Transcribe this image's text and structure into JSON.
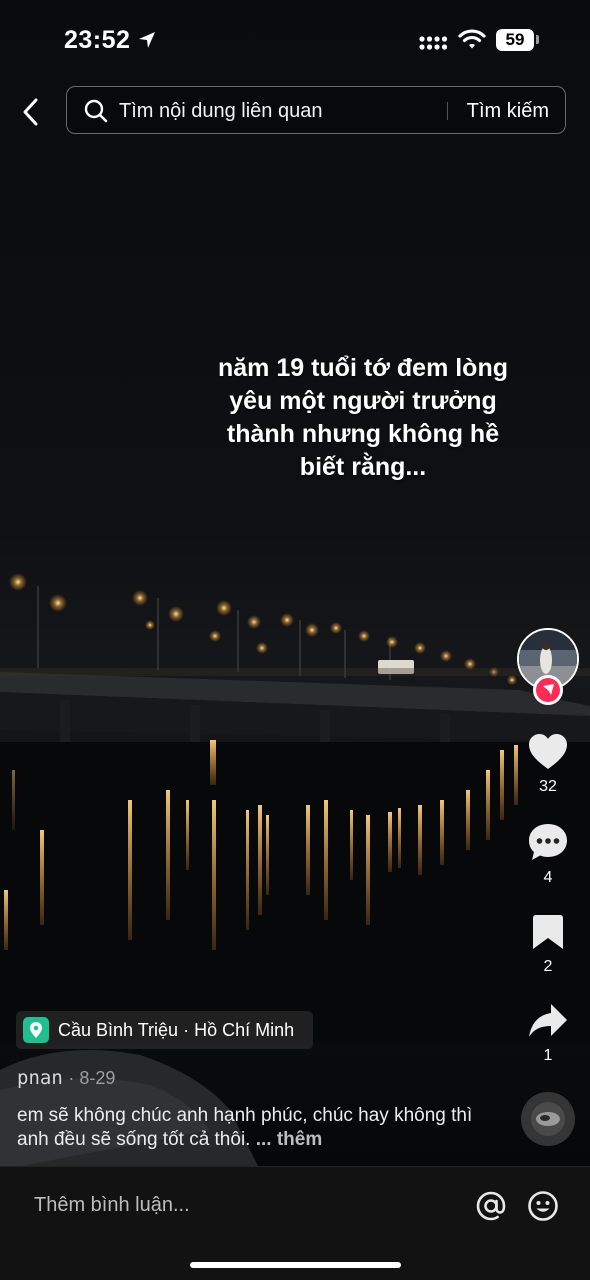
{
  "status_bar": {
    "time": "23:52",
    "battery": "59"
  },
  "search": {
    "placeholder": "Tìm nội dung liên quan",
    "button": "Tìm kiếm"
  },
  "overlay": {
    "lines": [
      "năm 19 tuổi tớ đem lòng",
      "yêu một người trưởng",
      "thành nhưng không hề",
      "biết rằng..."
    ]
  },
  "actions": {
    "likes": "32",
    "comments": "4",
    "bookmarks": "2",
    "shares": "1"
  },
  "location": {
    "text": "Cầu Bình Triệu · Hồ Chí Minh"
  },
  "author": {
    "name": "pnan",
    "date": "· 8-29"
  },
  "description": {
    "text": "em sẽ không chúc anh hạnh phúc, chúc hay không thì anh đều sẽ sống tốt cả thôi.",
    "more": "... thêm"
  },
  "comment_bar": {
    "placeholder": "Thêm bình luận..."
  },
  "colors": {
    "background": "#0b0c0e",
    "accent": "#fe2c55",
    "location_pin": "#1fbf8f"
  },
  "icons": [
    "location-arrow-icon",
    "signal-icon",
    "wifi-icon",
    "back-chevron-icon",
    "search-icon",
    "heart-icon",
    "comment-bubble-icon",
    "bookmark-icon",
    "share-arrow-icon",
    "music-disc-icon",
    "at-icon",
    "emoji-icon"
  ]
}
